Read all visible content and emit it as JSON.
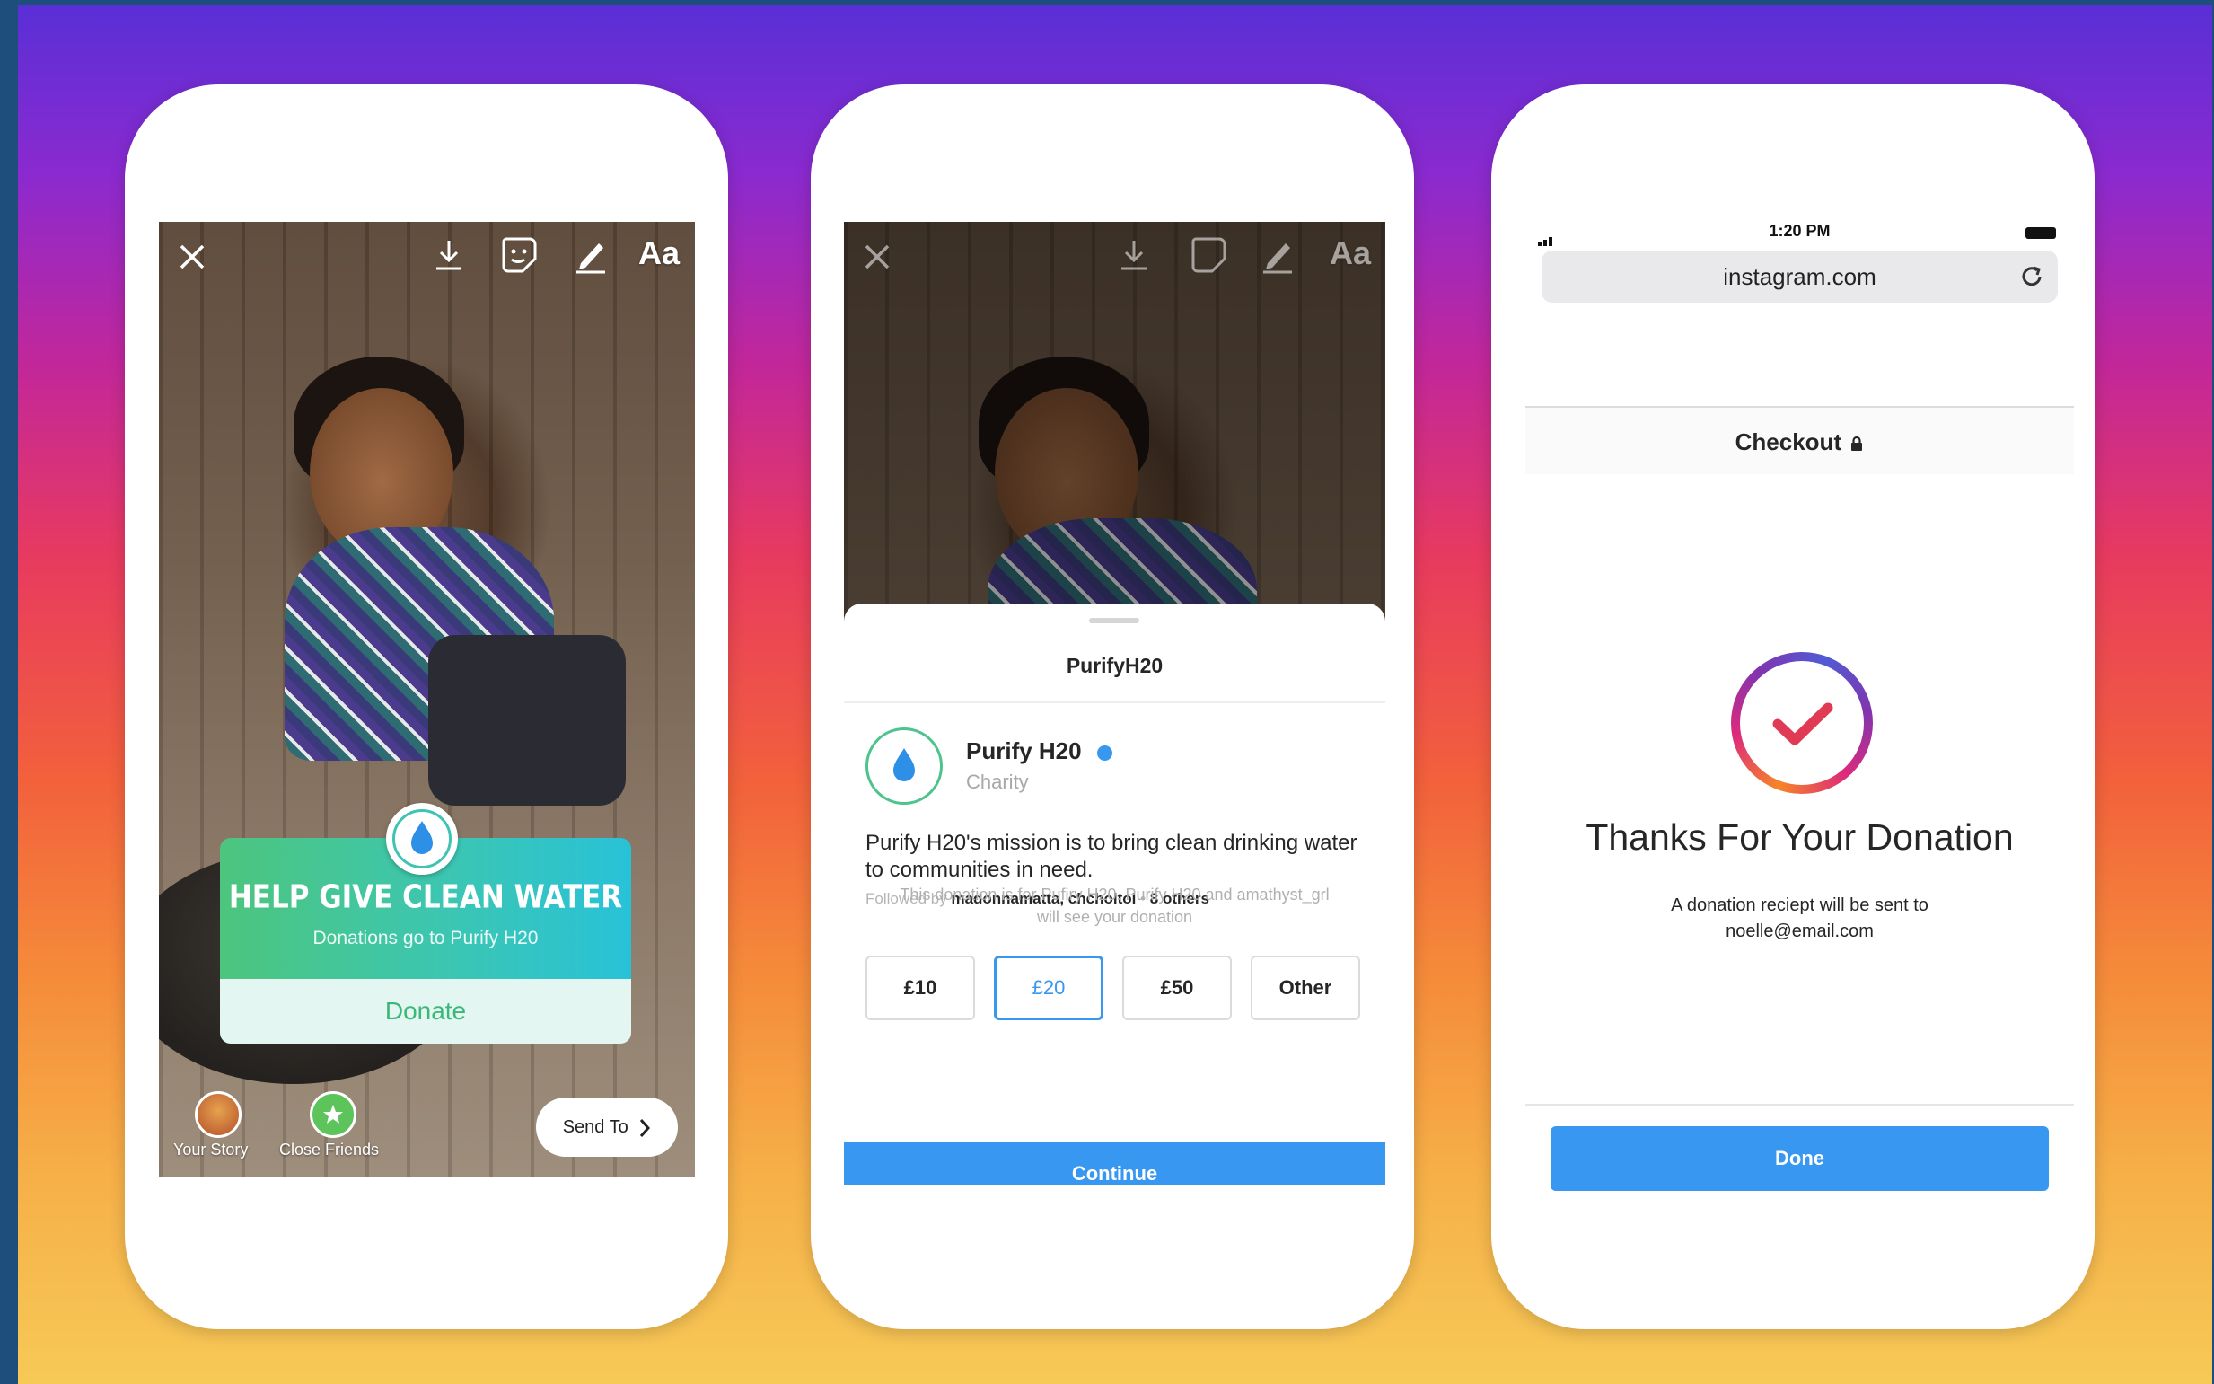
{
  "colors": {
    "instagram_blue": "#3897f0",
    "sticker_green": "#4dc57d",
    "sticker_teal": "#28c2d8",
    "gradient_top": "#5a2fd6",
    "gradient_bottom": "#f7c957"
  },
  "phone1": {
    "top_tools": {
      "close_icon": "close-icon",
      "download_icon": "download-icon",
      "sticker_icon": "sticker-icon",
      "draw_icon": "pen-icon",
      "text_tool": "Aa"
    },
    "sticker": {
      "title": "HELP GIVE CLEAN WATER",
      "subtitle": "Donations go to Purify H20",
      "button": "Donate"
    },
    "bottom": {
      "your_story": "Your Story",
      "close_friends": "Close Friends",
      "send_to": "Send To"
    }
  },
  "phone2": {
    "top_tools": {
      "text_tool": "Aa"
    },
    "sheet": {
      "title": "PurifyH20",
      "org_name": "Purify H20",
      "org_category": "Charity",
      "mission": "Purify H20's mission is to bring clean drinking water to communities in need.",
      "followed_prefix": "Followed by",
      "followed_names": "madonnamatta, chchoitoi",
      "followed_sep": "•",
      "followed_others": "8 others",
      "amounts": [
        "£10",
        "£20",
        "£50",
        "Other"
      ],
      "selected_amount": "£20",
      "disclaimer": "This donation is for Pufiry H20. Purify H20 and amathyst_grl will see your donation",
      "continue": "Continue"
    }
  },
  "phone3": {
    "status": {
      "time": "1:20 PM"
    },
    "url": "instagram.com",
    "checkout": "Checkout",
    "thanks": "Thanks For Your Donation",
    "receipt_line1": "A donation reciept will be sent to",
    "receipt_email": "noelle@email.com",
    "done": "Done"
  }
}
